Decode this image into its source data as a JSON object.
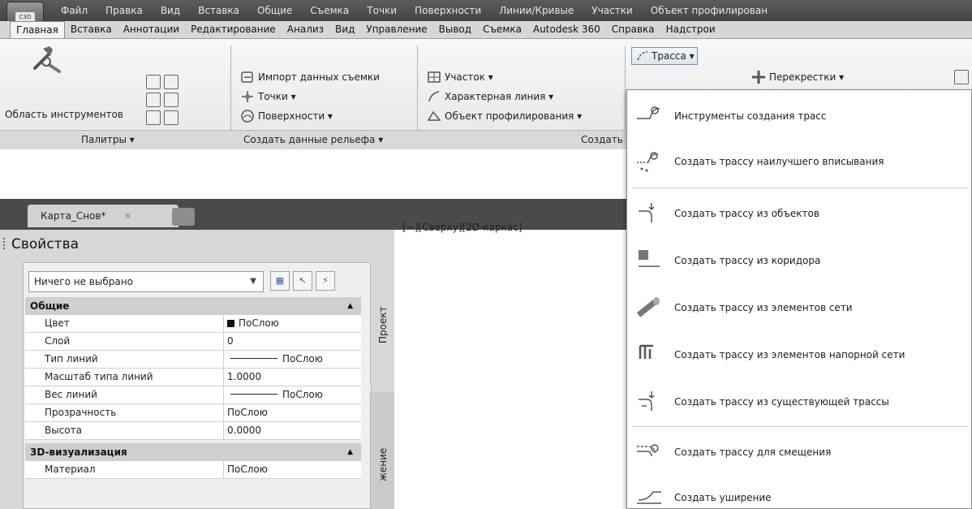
{
  "menubar": {
    "items": [
      "Файл",
      "Правка",
      "Вид",
      "Вставка",
      "Общие",
      "Съемка",
      "Точки",
      "Поверхности",
      "Линии/Кривые",
      "Участки",
      "Объект профилирован"
    ]
  },
  "ribbon_tabs": [
    "Главная",
    "Вставка",
    "Аннотации",
    "Редактирование",
    "Анализ",
    "Вид",
    "Управление",
    "Вывод",
    "Съемка",
    "Autodesk 360",
    "Справка",
    "Надстрои"
  ],
  "ribbon": {
    "tools_label": "Область инструментов",
    "palettes_title": "Палитры ▾",
    "create_ground_title": "Создать данные рельефа ▾",
    "create_design_title": "Создать",
    "import_label": "Импорт данных съемки",
    "points_label": "Точки ▾",
    "surfaces_label": "Поверхности ▾",
    "site_label": "Участок ▾",
    "feature_line_label": "Характерная линия ▾",
    "grading_label": "Объект профилирования ▾",
    "alignment_label": "Трасса ▾",
    "intersections_label": "Перекрестки ▾"
  },
  "document": {
    "tab_name": "Карта_Снов*",
    "close_glyph": "✕",
    "viewport_label": "[−][Сверху][2D-каркас]"
  },
  "properties": {
    "title": "Свойства",
    "selection": "Ничего не выбрано",
    "groups": {
      "general": "Общие",
      "viz3d": "3D-визуализация"
    },
    "general_rows": [
      {
        "name": "Цвет",
        "value": "ПоСлою",
        "kind": "color"
      },
      {
        "name": "Слой",
        "value": "0",
        "kind": "text"
      },
      {
        "name": "Тип линий",
        "value": "ПоСлою",
        "kind": "line"
      },
      {
        "name": "Масштаб типа линий",
        "value": "1.0000",
        "kind": "text"
      },
      {
        "name": "Вес линий",
        "value": "ПоСлою",
        "kind": "line"
      },
      {
        "name": "Прозрачность",
        "value": "ПоСлою",
        "kind": "text"
      },
      {
        "name": "Высота",
        "value": "0.0000",
        "kind": "text"
      }
    ],
    "viz_rows": [
      {
        "name": "Материал",
        "value": "ПоСлою"
      }
    ],
    "side_tabs": [
      "Проект",
      "жение"
    ]
  },
  "alignment_menu": {
    "items": [
      "Инструменты создания трасс",
      "Создать трассу наилучшего вписывания",
      "Создать трассу из объектов",
      "Создать трассу из коридора",
      "Создать трассу из элементов сети",
      "Создать трассу из элементов напорной сети",
      "Создать трассу из существующей трассы",
      "Создать трассу для смещения",
      "Создать уширение"
    ]
  }
}
